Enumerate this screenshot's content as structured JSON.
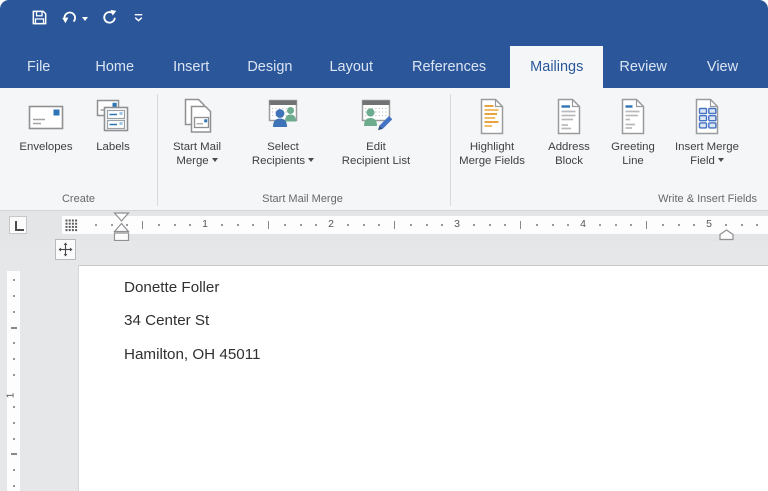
{
  "window": {
    "theme_color": "#2b579a"
  },
  "quick_access_toolbar": {
    "buttons": [
      {
        "name": "save",
        "icon": "save-icon"
      },
      {
        "name": "undo",
        "icon": "undo-icon",
        "has_dropdown": true
      },
      {
        "name": "repeat",
        "icon": "repeat-icon"
      },
      {
        "name": "customize-quick-access-toolbar",
        "icon": "customize-quick-access-icon"
      }
    ]
  },
  "tab_bar": {
    "active_tab": "Mailings",
    "tabs": [
      {
        "label": "File"
      },
      {
        "label": "Home"
      },
      {
        "label": "Insert"
      },
      {
        "label": "Design"
      },
      {
        "label": "Layout"
      },
      {
        "label": "References"
      },
      {
        "label": "Mailings"
      },
      {
        "label": "Review"
      },
      {
        "label": "View"
      }
    ]
  },
  "ribbon": {
    "groups": [
      {
        "label": "Create",
        "buttons": [
          {
            "lines": [
              "Envelopes"
            ],
            "icon": "envelopes-icon"
          },
          {
            "lines": [
              "Labels"
            ],
            "icon": "labels-icon"
          }
        ]
      },
      {
        "label": "Start Mail Merge",
        "buttons": [
          {
            "lines": [
              "Start Mail",
              "Merge"
            ],
            "icon": "start-mail-merge-icon",
            "has_dropdown": true
          },
          {
            "lines": [
              "Select",
              "Recipients"
            ],
            "icon": "select-recipients-icon",
            "has_dropdown": true
          },
          {
            "lines": [
              "Edit",
              "Recipient List"
            ],
            "icon": "edit-recipient-list-icon"
          }
        ]
      },
      {
        "label": "Write & Insert Fields",
        "buttons": [
          {
            "lines": [
              "Highlight",
              "Merge Fields"
            ],
            "icon": "highlight-merge-fields-icon"
          },
          {
            "lines": [
              "Address",
              "Block"
            ],
            "icon": "address-block-icon"
          },
          {
            "lines": [
              "Greeting",
              "Line"
            ],
            "icon": "greeting-line-icon"
          },
          {
            "lines": [
              "Insert Merge",
              "Field"
            ],
            "icon": "insert-merge-field-icon",
            "has_dropdown": true
          }
        ]
      }
    ]
  },
  "ruler": {
    "horizontal_numbers": [
      "1",
      "2",
      "3",
      "4",
      "5"
    ],
    "vertical_numbers": [
      "1"
    ]
  },
  "document": {
    "address_lines": [
      "Donette Foller",
      "34 Center St",
      "Hamilton, OH 45011"
    ]
  }
}
